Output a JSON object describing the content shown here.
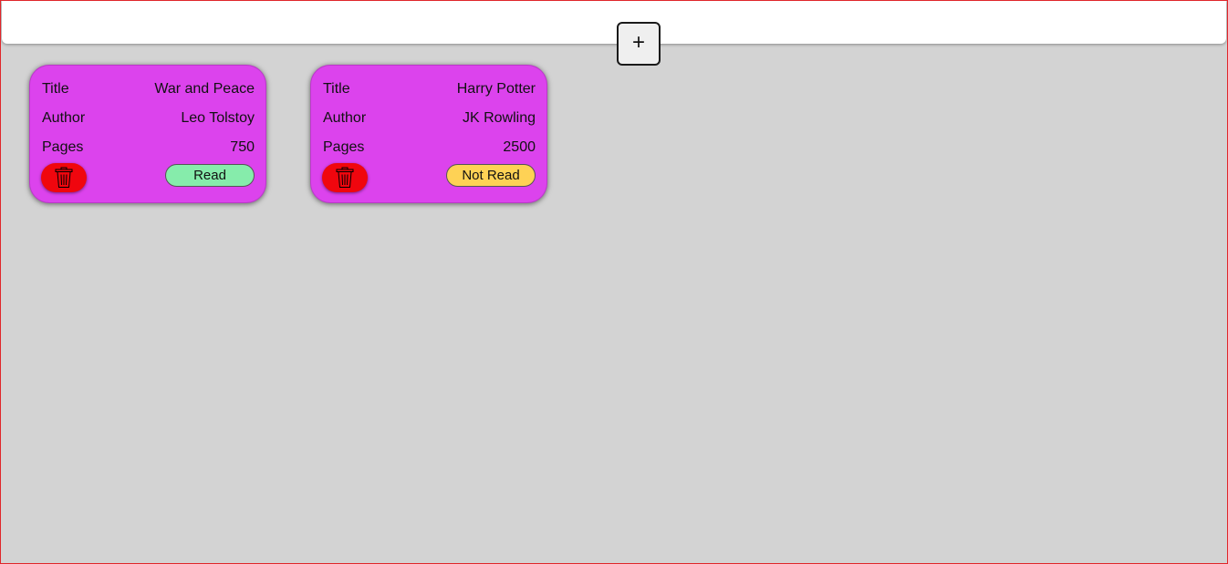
{
  "header": {
    "add_button_label": "+"
  },
  "colors": {
    "page_background": "#d3d3d3",
    "header_background": "#ffffff",
    "card_background": "#dc43ed",
    "delete_button": "#f0060e",
    "read_status": "#86ecab",
    "not_read_status": "#fed255"
  },
  "labels": {
    "title": "Title",
    "author": "Author",
    "pages": "Pages"
  },
  "books": [
    {
      "title": "War and Peace",
      "author": "Leo Tolstoy",
      "pages": "750",
      "status": "Read",
      "delete_icon": "trash-icon"
    },
    {
      "title": "Harry Potter",
      "author": "JK Rowling",
      "pages": "2500",
      "status": "Not Read",
      "delete_icon": "trash-icon"
    }
  ]
}
